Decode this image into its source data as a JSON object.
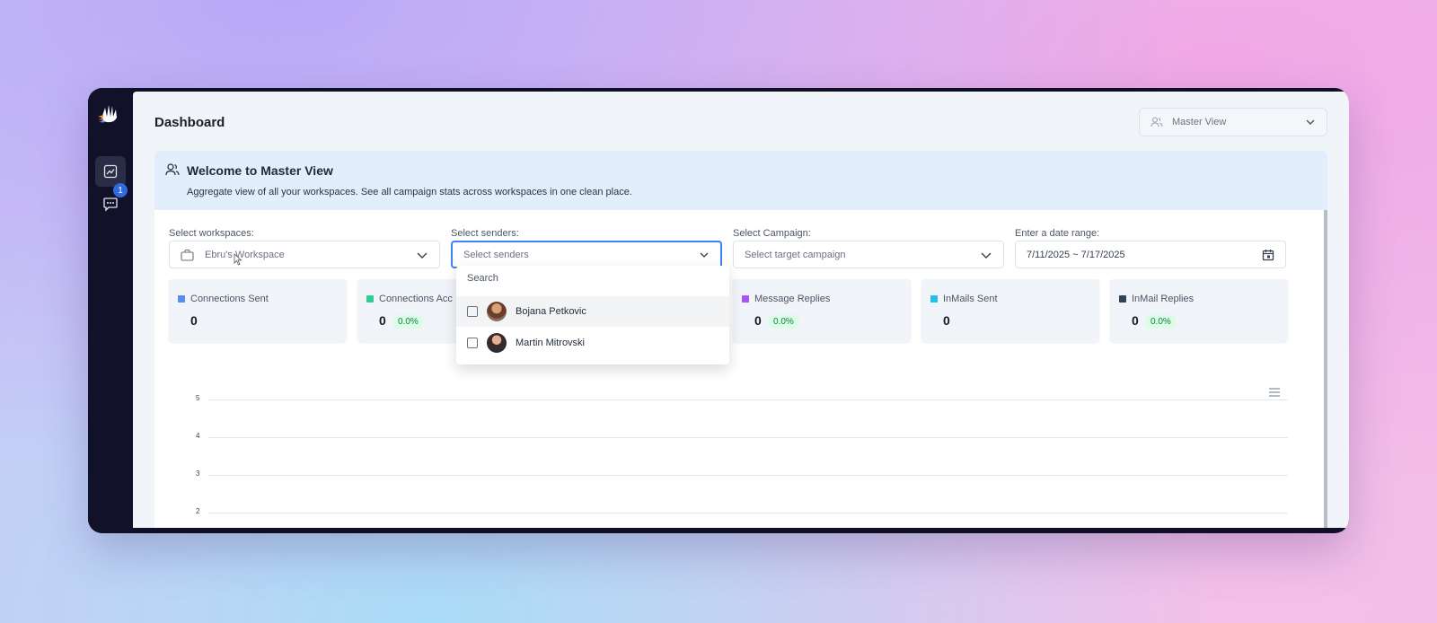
{
  "header": {
    "title": "Dashboard",
    "view_select": "Master View"
  },
  "sidebar": {
    "items": [
      {
        "icon": "chart-icon",
        "active": true
      },
      {
        "icon": "chat-icon",
        "badge": "1"
      }
    ]
  },
  "welcome": {
    "title": "Welcome to Master View",
    "description": "Aggregate view of all your workspaces. See all campaign stats across workspaces in one clean place."
  },
  "filters": {
    "workspaces": {
      "label": "Select workspaces:",
      "value": "Ebru's Workspace"
    },
    "senders": {
      "label": "Select senders:",
      "placeholder": "Select senders"
    },
    "campaign": {
      "label": "Select Campaign:",
      "placeholder": "Select target campaign"
    },
    "date": {
      "label": "Enter a date range:",
      "value": "7/11/2025 ~ 7/17/2025"
    }
  },
  "stats": [
    {
      "name": "Connections Sent",
      "value": "0",
      "pct": "",
      "color": "#5b8def"
    },
    {
      "name": "Connections Acc",
      "value": "0",
      "pct": "0.0%",
      "color": "#2bcf96"
    },
    {
      "name": "",
      "value": "",
      "pct": "",
      "color": ""
    },
    {
      "name": "Message Replies",
      "value": "0",
      "pct": "0.0%",
      "color": "#a855f7"
    },
    {
      "name": "InMails Sent",
      "value": "0",
      "pct": "",
      "color": "#22c2e8"
    },
    {
      "name": "InMail Replies",
      "value": "0",
      "pct": "0.0%",
      "color": "#334155"
    }
  ],
  "senders_dropdown": {
    "search_placeholder": "Search",
    "options": [
      {
        "name": "Bojana Petkovic",
        "checked": false
      },
      {
        "name": "Martin Mitrovski",
        "checked": false
      }
    ]
  },
  "chart": {
    "y_ticks": [
      "5",
      "4",
      "3",
      "2"
    ]
  }
}
